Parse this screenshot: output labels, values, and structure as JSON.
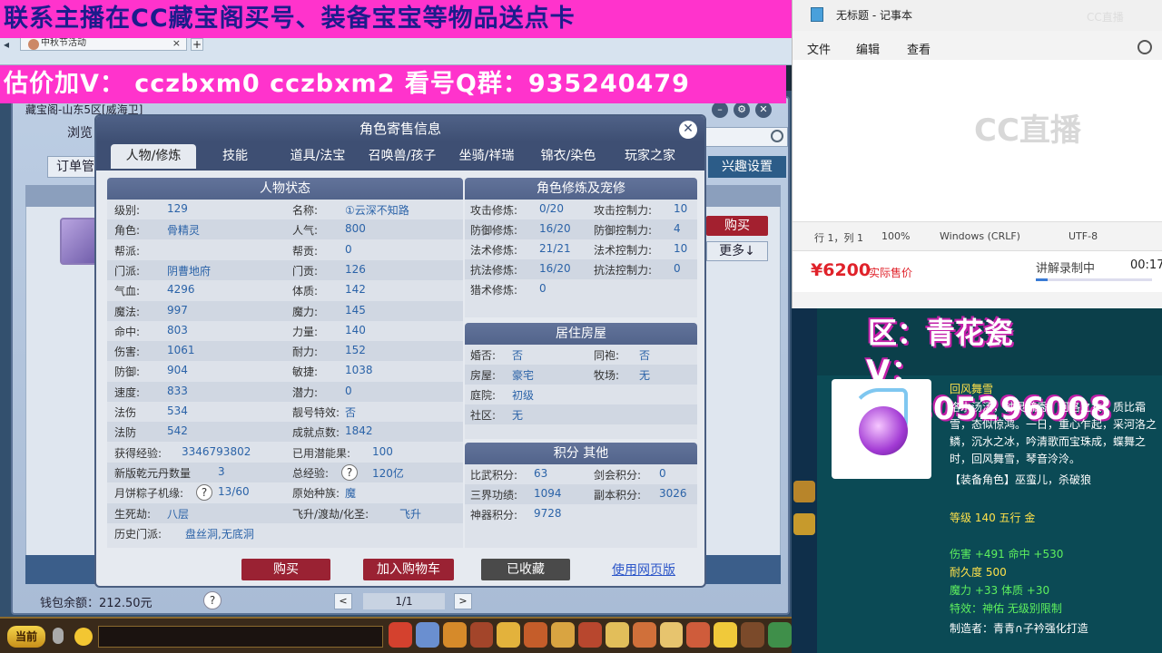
{
  "overlay": {
    "top_banner": "联系主播在CC藏宝阁买号、装备宝宝等物品送点卡",
    "mid_banner": "估价加V： cczbxm0 cczbxm2 看号Q群：935240479"
  },
  "browser": {
    "tab_label": "中秋节活动",
    "tab_close": "×",
    "tab_add": "+"
  },
  "shop": {
    "title": "藏宝阁-山东5区[威海卫]",
    "nav": [
      "浏览"
    ],
    "order_button": "订单管",
    "interest_button": "兴趣设置",
    "list_buy": "购买",
    "list_more": "更多↓",
    "wallet": "钱包余额：212.50元",
    "pager": "1/1",
    "prev": "<",
    "next": ">",
    "help": "?"
  },
  "dialog": {
    "title": "角色寄售信息",
    "close": "✕",
    "tabs": [
      "人物/修炼",
      "技能",
      "道具/法宝",
      "召唤兽/孩子",
      "坐骑/祥瑞",
      "锦衣/染色",
      "玩家之家"
    ],
    "status_head": "人物状态",
    "status_left": [
      {
        "label": "级别:",
        "value": "129"
      },
      {
        "label": "角色:",
        "value": "骨精灵"
      },
      {
        "label": "帮派:",
        "value": ""
      },
      {
        "label": "门派:",
        "value": "阴曹地府"
      },
      {
        "label": "气血:",
        "value": "4296"
      },
      {
        "label": "魔法:",
        "value": "997"
      },
      {
        "label": "命中:",
        "value": "803"
      },
      {
        "label": "伤害:",
        "value": "1061"
      },
      {
        "label": "防御:",
        "value": "904"
      },
      {
        "label": "速度:",
        "value": "833"
      },
      {
        "label": "法伤",
        "value": "534"
      },
      {
        "label": "法防",
        "value": "542"
      },
      {
        "label": "获得经验:",
        "value": "3346793802"
      },
      {
        "label": "新版乾元丹数量",
        "value": "3"
      },
      {
        "label": "月饼粽子机缘:",
        "value": "13/60"
      },
      {
        "label": "生死劫:",
        "value": "八层"
      }
    ],
    "status_right": [
      {
        "label": "名称:",
        "value": "①云深不知路"
      },
      {
        "label": "人气:",
        "value": "800"
      },
      {
        "label": "帮贡:",
        "value": "0"
      },
      {
        "label": "门贡:",
        "value": "126"
      },
      {
        "label": "体质:",
        "value": "142"
      },
      {
        "label": "魔力:",
        "value": "145"
      },
      {
        "label": "力量:",
        "value": "140"
      },
      {
        "label": "耐力:",
        "value": "152"
      },
      {
        "label": "敏捷:",
        "value": "1038"
      },
      {
        "label": "潜力:",
        "value": "0"
      },
      {
        "label": "靓号特效:",
        "value": "否"
      },
      {
        "label": "成就点数:",
        "value": "1842"
      },
      {
        "label": "已用潜能果:",
        "value": "100"
      },
      {
        "label": "总经验:",
        "value": "120亿"
      },
      {
        "label": "原始种族:",
        "value": "魔"
      },
      {
        "label": "飞升/渡劫/化圣:",
        "value": "飞升"
      }
    ],
    "history_label": "历史门派:",
    "history_value": "盘丝洞,无底洞",
    "cult_head": "角色修炼及宠修",
    "cult_left": [
      {
        "label": "攻击修炼:",
        "value": "0/20"
      },
      {
        "label": "防御修炼:",
        "value": "16/20"
      },
      {
        "label": "法术修炼:",
        "value": "21/21"
      },
      {
        "label": "抗法修炼:",
        "value": "16/20"
      },
      {
        "label": "猎术修炼:",
        "value": "0"
      }
    ],
    "cult_right": [
      {
        "label": "攻击控制力:",
        "value": "10"
      },
      {
        "label": "防御控制力:",
        "value": "4"
      },
      {
        "label": "法术控制力:",
        "value": "10"
      },
      {
        "label": "抗法控制力:",
        "value": "0"
      }
    ],
    "house_head": "居住房屋",
    "house_left": [
      {
        "label": "婚否:",
        "value": "否"
      },
      {
        "label": "房屋:",
        "value": "豪宅"
      },
      {
        "label": "庭院:",
        "value": "初级"
      },
      {
        "label": "社区:",
        "value": "无"
      }
    ],
    "house_right": [
      {
        "label": "同袍:",
        "value": "否"
      },
      {
        "label": "牧场:",
        "value": "无"
      }
    ],
    "score_head": "积分 其他",
    "score_left": [
      {
        "label": "比武积分:",
        "value": "63"
      },
      {
        "label": "三界功绩:",
        "value": "1094"
      },
      {
        "label": "神器积分:",
        "value": "9728"
      }
    ],
    "score_right": [
      {
        "label": "剑会积分:",
        "value": "0"
      },
      {
        "label": "副本积分:",
        "value": "3026"
      }
    ],
    "buy": "购买",
    "cart": "加入购物车",
    "fav": "已收藏",
    "web_link": "使用网页版",
    "help": "?"
  },
  "game_bar": {
    "current": "当前"
  },
  "notepad": {
    "title": "无标题 - 记事本",
    "watermark": "CC直播",
    "menu": [
      "文件",
      "编辑",
      "查看"
    ],
    "logo": "CC直播",
    "status": [
      "行 1，列 1",
      "100%",
      "Windows (CRLF)",
      "UTF-8"
    ]
  },
  "price_bar": {
    "price": "¥6200",
    "label": "实际售价",
    "record_label": "讲解录制中",
    "record_time": "00:17",
    "progress": 0.1
  },
  "item": {
    "promo_region": "区：青花瓷",
    "promo_v": "V：18805296008",
    "name": "回风舞雪",
    "desc": "洛水汤汤，钟灵毓秀。河洛之女，质比霜雪，态似惊鸿。一日，重心乍起，采河洛之鳞，沉水之冰，吟清歌而宝珠成，蝶舞之时，回风舞雪，琴音泠泠。",
    "role": "【装备角色】巫蛮儿，杀破狼",
    "level": "等级 140  五行 金",
    "attr1": "伤害 +491  命中 +530",
    "durability": "耐久度 500",
    "attr2": "魔力 +33  体质 +30",
    "effect": "特效：神佑  无级别限制",
    "maker": "制造者：青青∩子衿强化打造"
  }
}
